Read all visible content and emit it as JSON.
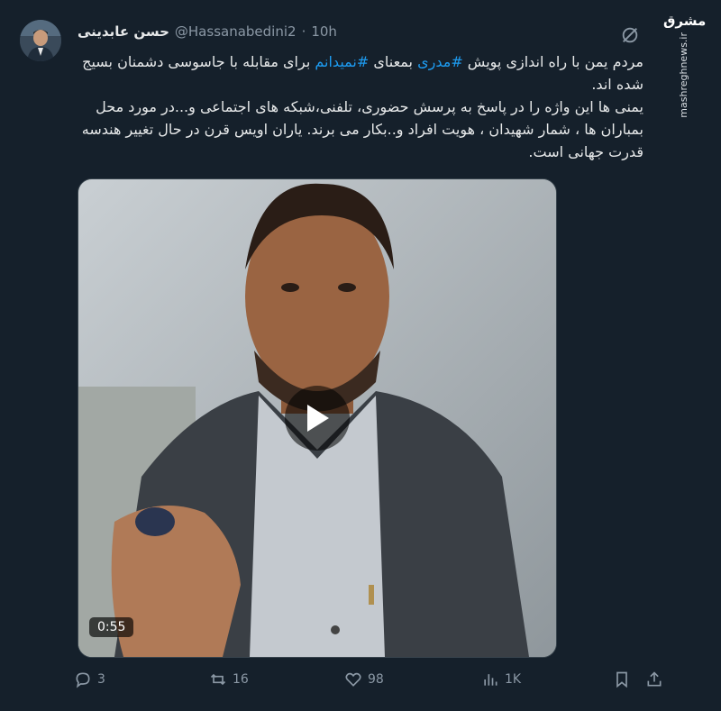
{
  "author": {
    "name": "حسن عابدینی",
    "handle": "@Hassanabedini2",
    "separator": "·",
    "time": "10h"
  },
  "watermark": {
    "logo_text": "مشرق",
    "site": "mashreghnews.ir"
  },
  "tweet": {
    "line1_pre": "مردم یمن با راه اندازی پویش ",
    "tag1": "#مدری",
    "line1_mid": " بمعنای ",
    "tag2": "#نمیدانم",
    "line1_post": " برای مقابله با جاسوسی دشمنان بسیج شده اند.",
    "para2": "یمنی ها این واژه را در پاسخ به پرسش حضوری، تلفنی،شبکه های اجتماعی و...در مورد محل بمباران ها ، شمار شهیدان ، هویت افراد و..بکار می برند. یاران اویس قرن در حال تغییر هندسه قدرت جهانی است."
  },
  "video": {
    "duration": "0:55"
  },
  "actions": {
    "replies": "3",
    "retweets": "16",
    "likes": "98",
    "views": "1K"
  },
  "icons": [
    "grok-icon",
    "reply-icon",
    "retweet-icon",
    "like-icon",
    "views-icon",
    "bookmark-icon",
    "share-icon",
    "play-icon"
  ],
  "colors": {
    "background": "#15202b",
    "text": "#e7e9ea",
    "muted": "#8b98a5",
    "link": "#1d9bf0"
  }
}
